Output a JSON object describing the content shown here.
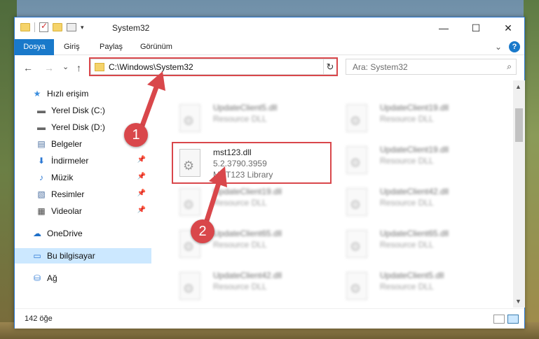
{
  "window": {
    "title": "System32",
    "controls": {
      "minimize": "—",
      "maximize": "☐",
      "close": "✕"
    }
  },
  "ribbon": {
    "tabs": [
      "Dosya",
      "Giriş",
      "Paylaş",
      "Görünüm"
    ],
    "help": "?",
    "expand": "⌄"
  },
  "nav": {
    "back": "←",
    "forward": "→",
    "recent": "⌄",
    "up": "↑",
    "address": "C:\\Windows\\System32",
    "refresh": "↻",
    "search_placeholder": "Ara: System32",
    "search_icon": "⌕"
  },
  "sidebar": {
    "items": [
      {
        "label": "Hızlı erişim",
        "icon": "★",
        "pinned": false
      },
      {
        "label": "Yerel Disk (C:)",
        "icon": "▬",
        "pinned": false
      },
      {
        "label": "Yerel Disk (D:)",
        "icon": "▬",
        "pinned": false
      },
      {
        "label": "Belgeler",
        "icon": "▤",
        "pinned": false
      },
      {
        "label": "İndirmeler",
        "icon": "⬇",
        "pinned": true
      },
      {
        "label": "Müzik",
        "icon": "♪",
        "pinned": true
      },
      {
        "label": "Resimler",
        "icon": "▧",
        "pinned": true
      },
      {
        "label": "Videolar",
        "icon": "▦",
        "pinned": true
      },
      {
        "label": "OneDrive",
        "icon": "☁",
        "pinned": false
      },
      {
        "label": "Bu bilgisayar",
        "icon": "▭",
        "pinned": false,
        "selected": true
      },
      {
        "label": "Ağ",
        "icon": "⛁",
        "pinned": false
      }
    ],
    "pin_icon": "✎"
  },
  "files": {
    "highlighted": {
      "name": "mst123.dll",
      "version": "5.2.3790.3959",
      "description": "MST123 Library"
    },
    "items": [
      {
        "name": "UpdateClient5.dll",
        "type": "Resource DLL"
      },
      {
        "name": "UpdateClient19.dll",
        "type": "Resource DLL"
      },
      {
        "name": "UpdateClient19.dll",
        "type": "Resource DLL"
      },
      {
        "name": "UpdateClient19.dll",
        "type": "Resource DLL"
      },
      {
        "name": "UpdateClient42.dll",
        "type": "Resource DLL"
      },
      {
        "name": "UpdateClient65.dll",
        "type": "Resource DLL"
      },
      {
        "name": "UpdateClient65.dll",
        "type": "Resource DLL"
      },
      {
        "name": "UpdateClient42.dll",
        "type": "Resource DLL"
      },
      {
        "name": "UpdateClient5.dll",
        "type": "Resource DLL"
      }
    ],
    "gear_icon": "⚙"
  },
  "status": {
    "count": "142 öğe"
  },
  "annotations": {
    "badge1": "1",
    "badge2": "2",
    "highlight_color": "#d9474b"
  }
}
